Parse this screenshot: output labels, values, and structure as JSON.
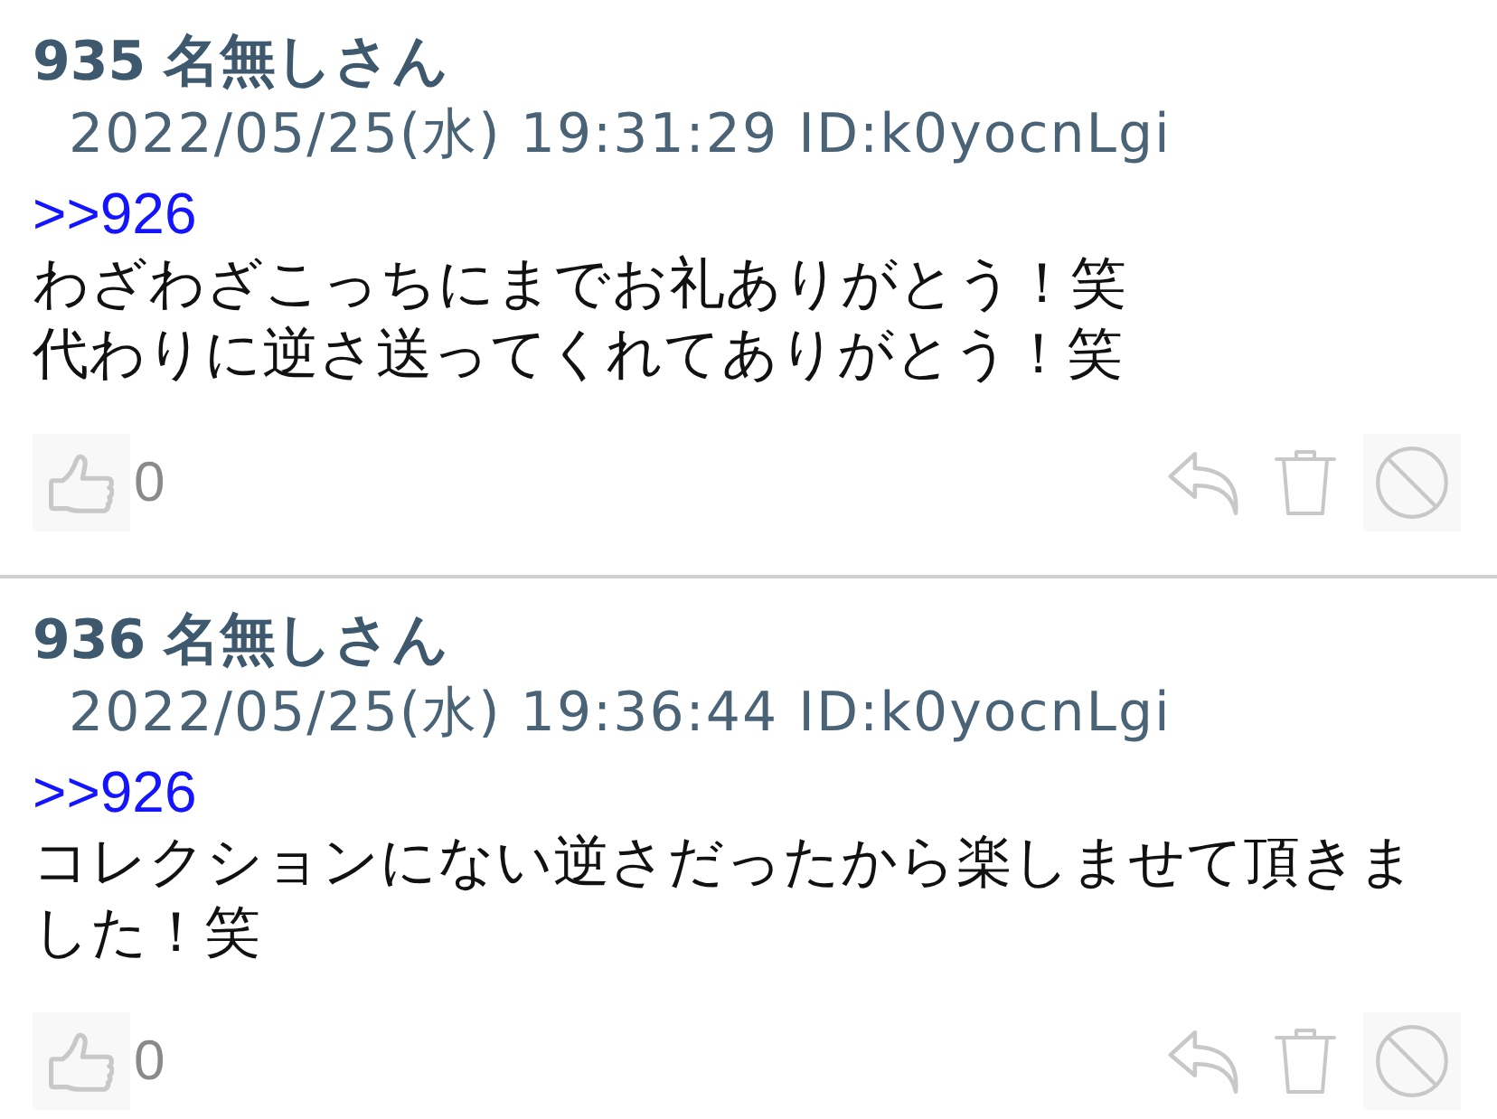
{
  "posts": [
    {
      "number": "935",
      "name": "名無しさん",
      "date": "2022/05/25(水) 19:31:29",
      "id": "ID:k0yocnLgi",
      "anchor": ">>926",
      "lines": [
        "わざわざこっちにまでお礼ありがとう！笑",
        "代わりに逆さ送ってくれてありがとう！笑"
      ],
      "likes": "0"
    },
    {
      "number": "936",
      "name": "名無しさん",
      "date": "2022/05/25(水) 19:36:44",
      "id": "ID:k0yocnLgi",
      "anchor": ">>926",
      "lines": [
        "コレクションにない逆さだったから楽しませて頂きました！笑"
      ],
      "likes": "0"
    }
  ]
}
